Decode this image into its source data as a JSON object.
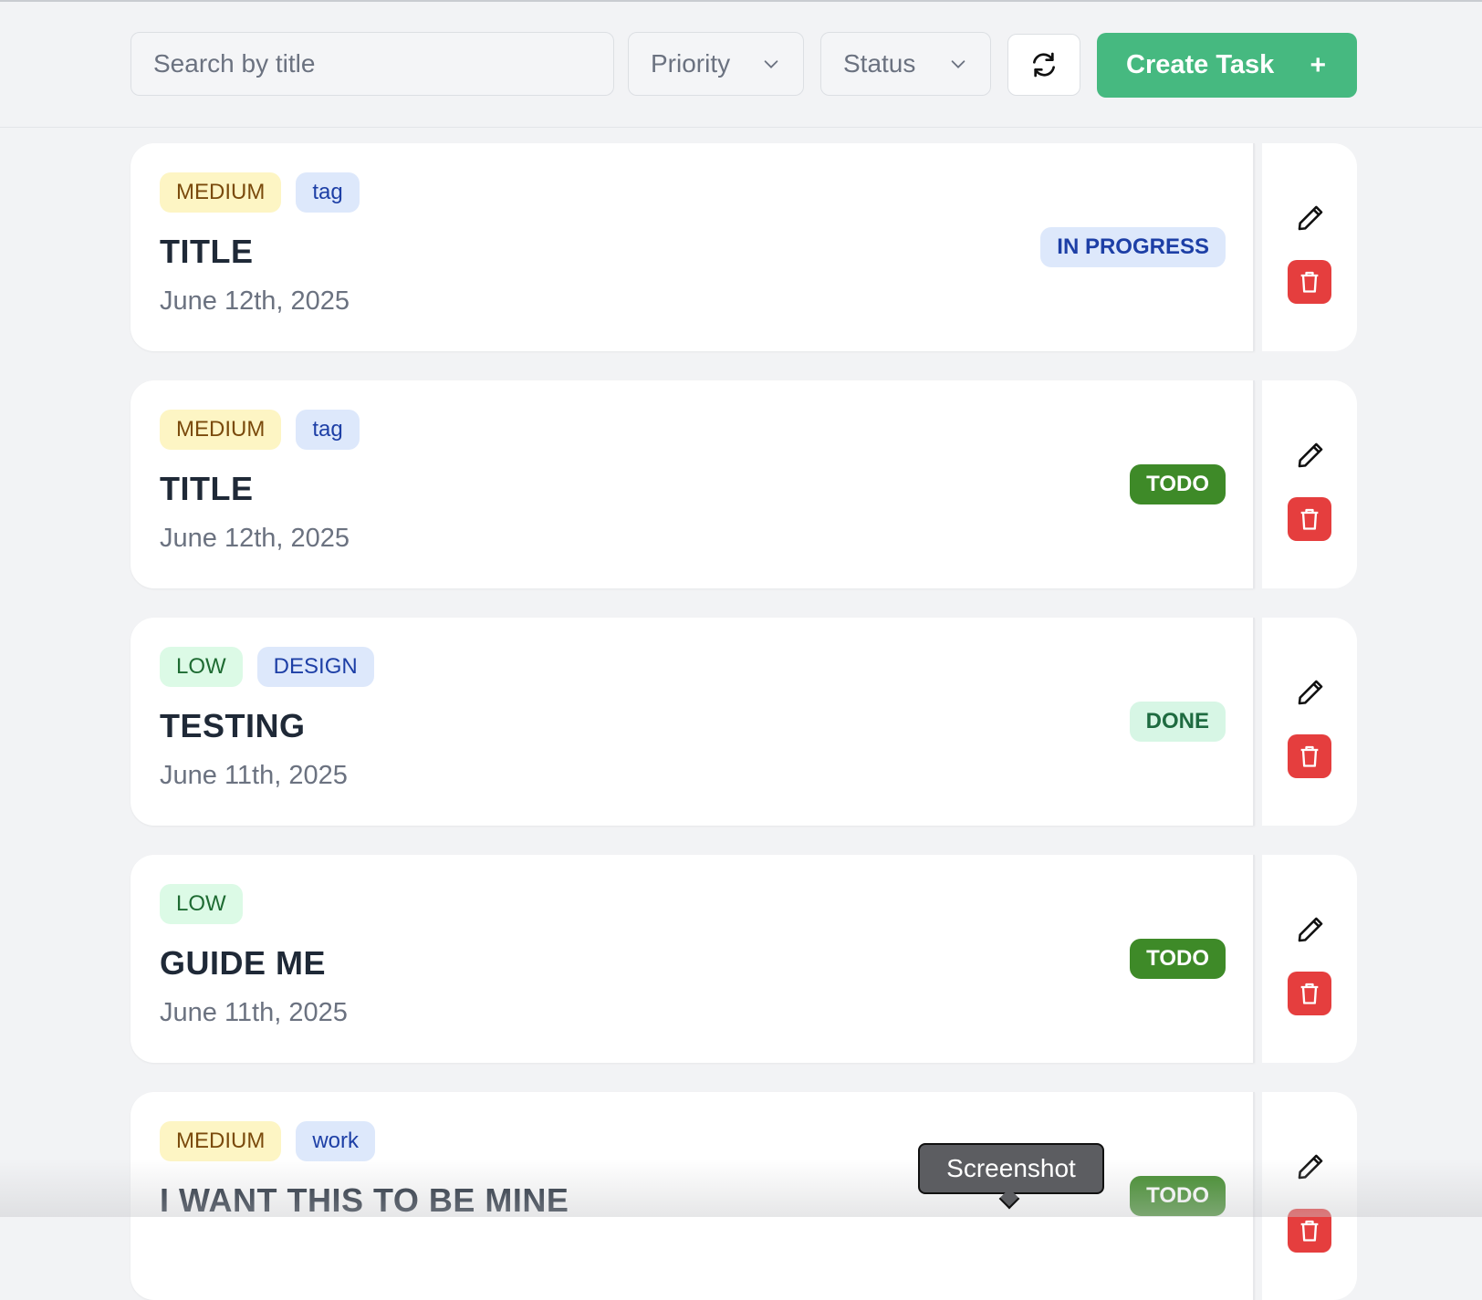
{
  "toolbar": {
    "search_placeholder": "Search by title",
    "priority_label": "Priority",
    "status_label": "Status",
    "refresh_icon": "refresh-icon",
    "create_label": "Create Task",
    "create_plus": "+"
  },
  "tasks": [
    {
      "priority": "MEDIUM",
      "tag": "tag",
      "title": "TITLE",
      "date": "June 12th, 2025",
      "status": "IN PROGRESS"
    },
    {
      "priority": "MEDIUM",
      "tag": "tag",
      "title": "TITLE",
      "date": "June 12th, 2025",
      "status": "TODO"
    },
    {
      "priority": "LOW",
      "tag": "DESIGN",
      "title": "TESTING",
      "date": "June 11th, 2025",
      "status": "DONE"
    },
    {
      "priority": "LOW",
      "title": "GUIDE ME",
      "date": "June 11th, 2025",
      "status": "TODO"
    },
    {
      "priority": "MEDIUM",
      "tag": "work",
      "title": "I WANT THIS TO BE MINE",
      "status": "TODO"
    }
  ],
  "tooltip": {
    "text": "Screenshot"
  },
  "colors": {
    "accent_green": "#46b980",
    "todo_green": "#3e8a28",
    "delete_red": "#e53e3e",
    "medium_bg": "#fdf5c4",
    "low_bg": "#dcfae6",
    "tag_bg": "#dde8fb"
  }
}
